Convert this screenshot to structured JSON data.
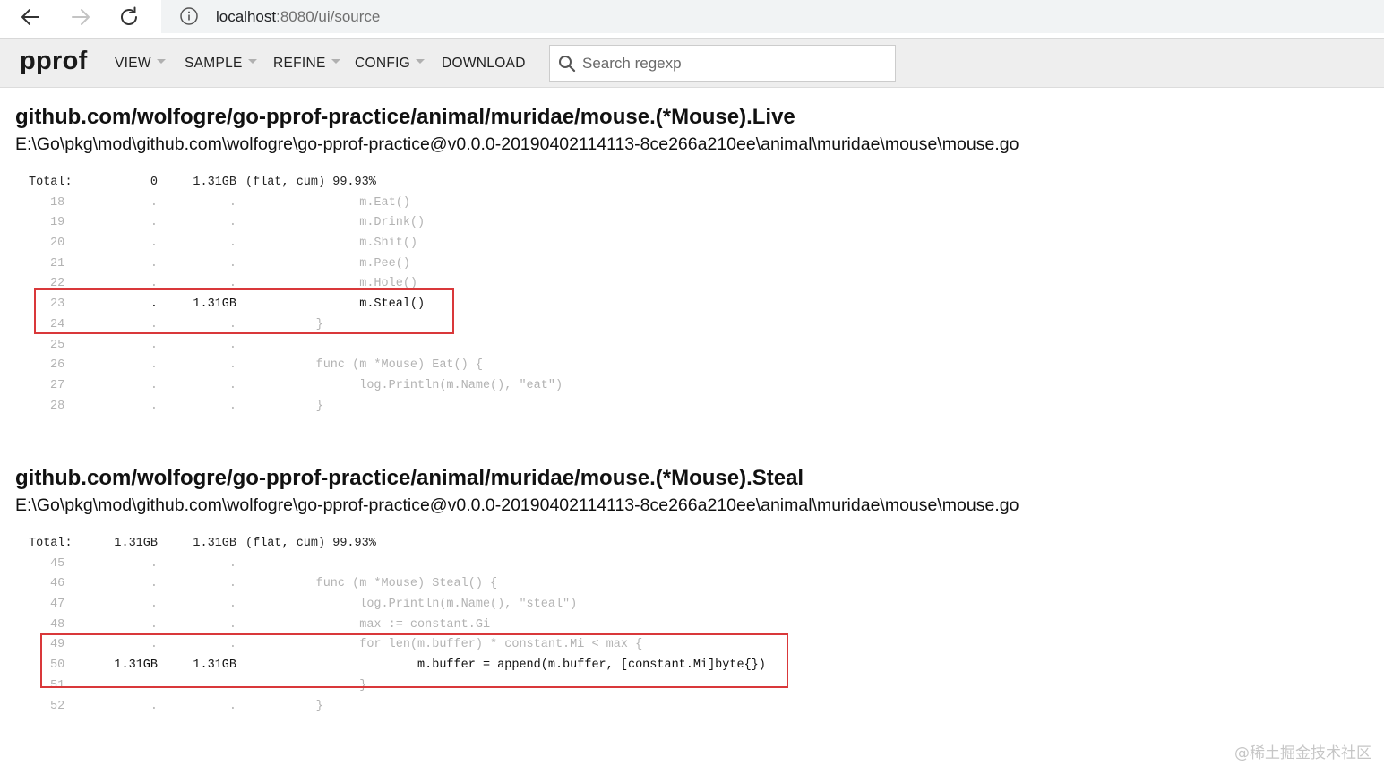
{
  "browser": {
    "url_host": "localhost",
    "url_path": ":8080/ui/source"
  },
  "toolbar": {
    "logo": "pprof",
    "menus": [
      "VIEW",
      "SAMPLE",
      "REFINE",
      "CONFIG",
      "DOWNLOAD"
    ],
    "search_placeholder": "Search regexp"
  },
  "sections": [
    {
      "title": "github.com/wolfogre/go-pprof-practice/animal/muridae/mouse.(*Mouse).Live",
      "path": "E:\\Go\\pkg\\mod\\github.com\\wolfogre\\go-pprof-practice@v0.0.0-20190402114113-8ce266a210ee\\animal\\muridae\\mouse\\mouse.go",
      "total": {
        "label": "Total:",
        "flat": "0",
        "cum": "1.31GB",
        "note": "(flat, cum) 99.93%"
      },
      "lines": [
        {
          "num": "18",
          "flat": ".",
          "cum": ".",
          "src": "            m.Eat()"
        },
        {
          "num": "19",
          "flat": ".",
          "cum": ".",
          "src": "            m.Drink()"
        },
        {
          "num": "20",
          "flat": ".",
          "cum": ".",
          "src": "            m.Shit()"
        },
        {
          "num": "21",
          "flat": ".",
          "cum": ".",
          "src": "            m.Pee()"
        },
        {
          "num": "22",
          "flat": ".",
          "cum": ".",
          "src": "            m.Hole()"
        },
        {
          "num": "23",
          "flat": ".",
          "cum": "1.31GB",
          "src": "            m.Steal()",
          "hot": true
        },
        {
          "num": "24",
          "flat": ".",
          "cum": ".",
          "src": "      }"
        },
        {
          "num": "25",
          "flat": ".",
          "cum": ".",
          "src": ""
        },
        {
          "num": "26",
          "flat": ".",
          "cum": ".",
          "src": "      func (m *Mouse) Eat() {"
        },
        {
          "num": "27",
          "flat": ".",
          "cum": ".",
          "src": "            log.Println(m.Name(), \"eat\")"
        },
        {
          "num": "28",
          "flat": ".",
          "cum": ".",
          "src": "      }"
        }
      ]
    },
    {
      "title": "github.com/wolfogre/go-pprof-practice/animal/muridae/mouse.(*Mouse).Steal",
      "path": "E:\\Go\\pkg\\mod\\github.com\\wolfogre\\go-pprof-practice@v0.0.0-20190402114113-8ce266a210ee\\animal\\muridae\\mouse\\mouse.go",
      "total": {
        "label": "Total:",
        "flat": "1.31GB",
        "cum": "1.31GB",
        "note": "(flat, cum) 99.93%"
      },
      "lines": [
        {
          "num": "45",
          "flat": ".",
          "cum": ".",
          "src": ""
        },
        {
          "num": "46",
          "flat": ".",
          "cum": ".",
          "src": "      func (m *Mouse) Steal() {"
        },
        {
          "num": "47",
          "flat": ".",
          "cum": ".",
          "src": "            log.Println(m.Name(), \"steal\")"
        },
        {
          "num": "48",
          "flat": ".",
          "cum": ".",
          "src": "            max := constant.Gi"
        },
        {
          "num": "49",
          "flat": ".",
          "cum": ".",
          "src": "            for len(m.buffer) * constant.Mi < max {"
        },
        {
          "num": "50",
          "flat": "1.31GB",
          "cum": "1.31GB",
          "src": "                    m.buffer = append(m.buffer, [constant.Mi]byte{})",
          "hot": true
        },
        {
          "num": "51",
          "flat": ".",
          "cum": ".",
          "src": "            }"
        },
        {
          "num": "52",
          "flat": ".",
          "cum": ".",
          "src": "      }"
        }
      ]
    }
  ],
  "watermark": "@稀土掘金技术社区"
}
